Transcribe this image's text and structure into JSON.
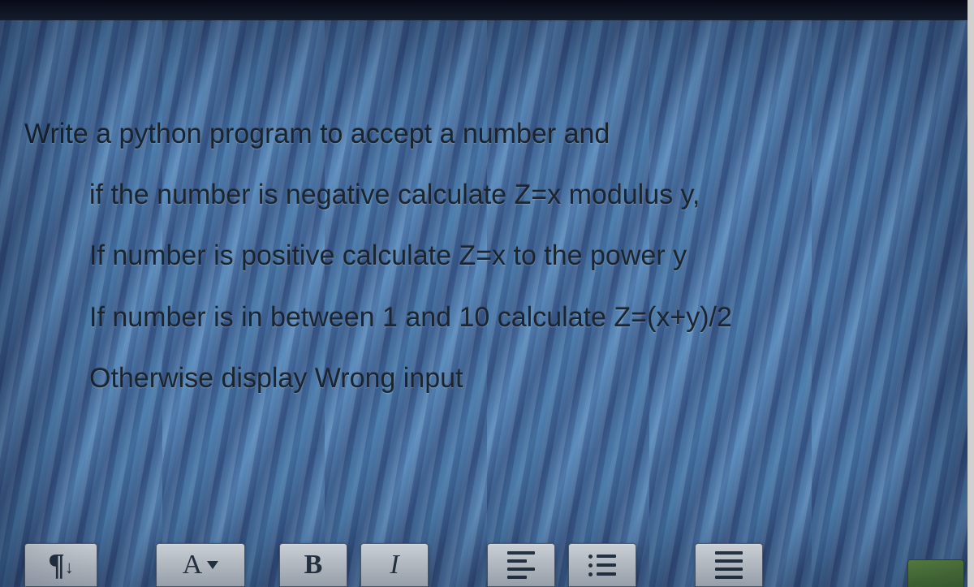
{
  "question": {
    "line1": "Write a python program to accept a number and",
    "line2": "if the number is negative calculate Z=x modulus y,",
    "line3": "If number is positive calculate Z=x to the power y",
    "line4": "If number is in between 1 and 10 calculate Z=(x+y)/2",
    "line5": "Otherwise display Wrong input"
  },
  "toolbar": {
    "paragraph_symbol": "¶",
    "font_label": "A",
    "bold_label": "B",
    "italic_label": "I"
  }
}
